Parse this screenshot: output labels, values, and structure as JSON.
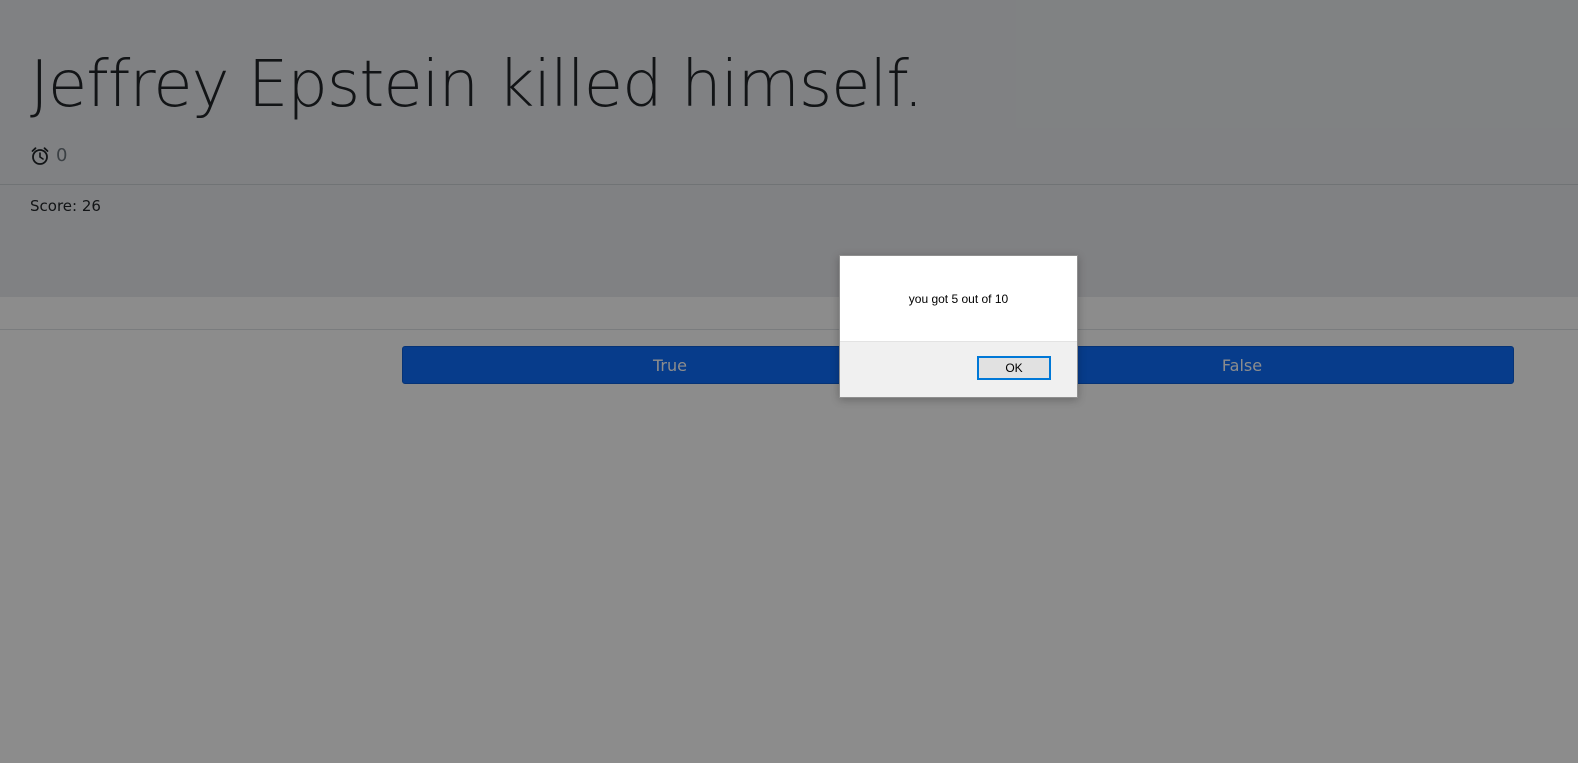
{
  "quiz": {
    "question": "Jeffrey Epstein killed himself.",
    "timer_value": "0",
    "timer_icon": "alarm-clock-icon",
    "score_text": "Score: 26"
  },
  "answers": {
    "true_label": "True",
    "false_label": "False",
    "button_color": "#0d6efd"
  },
  "alert": {
    "message": "you got 5 out of 10",
    "ok_label": "OK",
    "focus_color": "#0078d7"
  }
}
